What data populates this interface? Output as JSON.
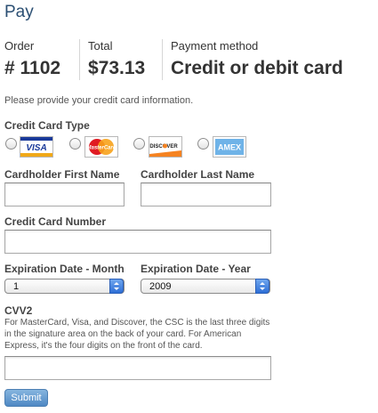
{
  "page": {
    "title": "Pay"
  },
  "summary": {
    "order_label": "Order",
    "order_value": "# 1102",
    "total_label": "Total",
    "total_value": "$73.13",
    "method_label": "Payment method",
    "method_value": "Credit or debit card"
  },
  "form": {
    "instructions": "Please provide your credit card information.",
    "card_type_label": "Credit Card Type",
    "card_types": [
      {
        "name": "VISA",
        "icon": "visa-logo-icon"
      },
      {
        "name": "MasterCard",
        "icon": "mastercard-logo-icon"
      },
      {
        "name": "DISCOVER",
        "icon": "discover-logo-icon"
      },
      {
        "name": "AMEX",
        "icon": "amex-logo-icon"
      }
    ],
    "first_name_label": "Cardholder First Name",
    "first_name_value": "",
    "last_name_label": "Cardholder Last Name",
    "last_name_value": "",
    "card_number_label": "Credit Card Number",
    "card_number_value": "",
    "exp_month_label": "Expiration Date - Month",
    "exp_month_value": "1",
    "exp_year_label": "Expiration Date - Year",
    "exp_year_value": "2009",
    "cvv_label": "CVV2",
    "cvv_help": "For MasterCard, Visa, and Discover, the CSC is the last three digits in the signature area on the back of your card. For American Express, it's the four digits on the front of the card.",
    "cvv_value": "",
    "submit_label": "Submit"
  },
  "colors": {
    "title": "#2b4f73",
    "submit": "#5b93cd",
    "select_arrow": "#3b7de0"
  }
}
